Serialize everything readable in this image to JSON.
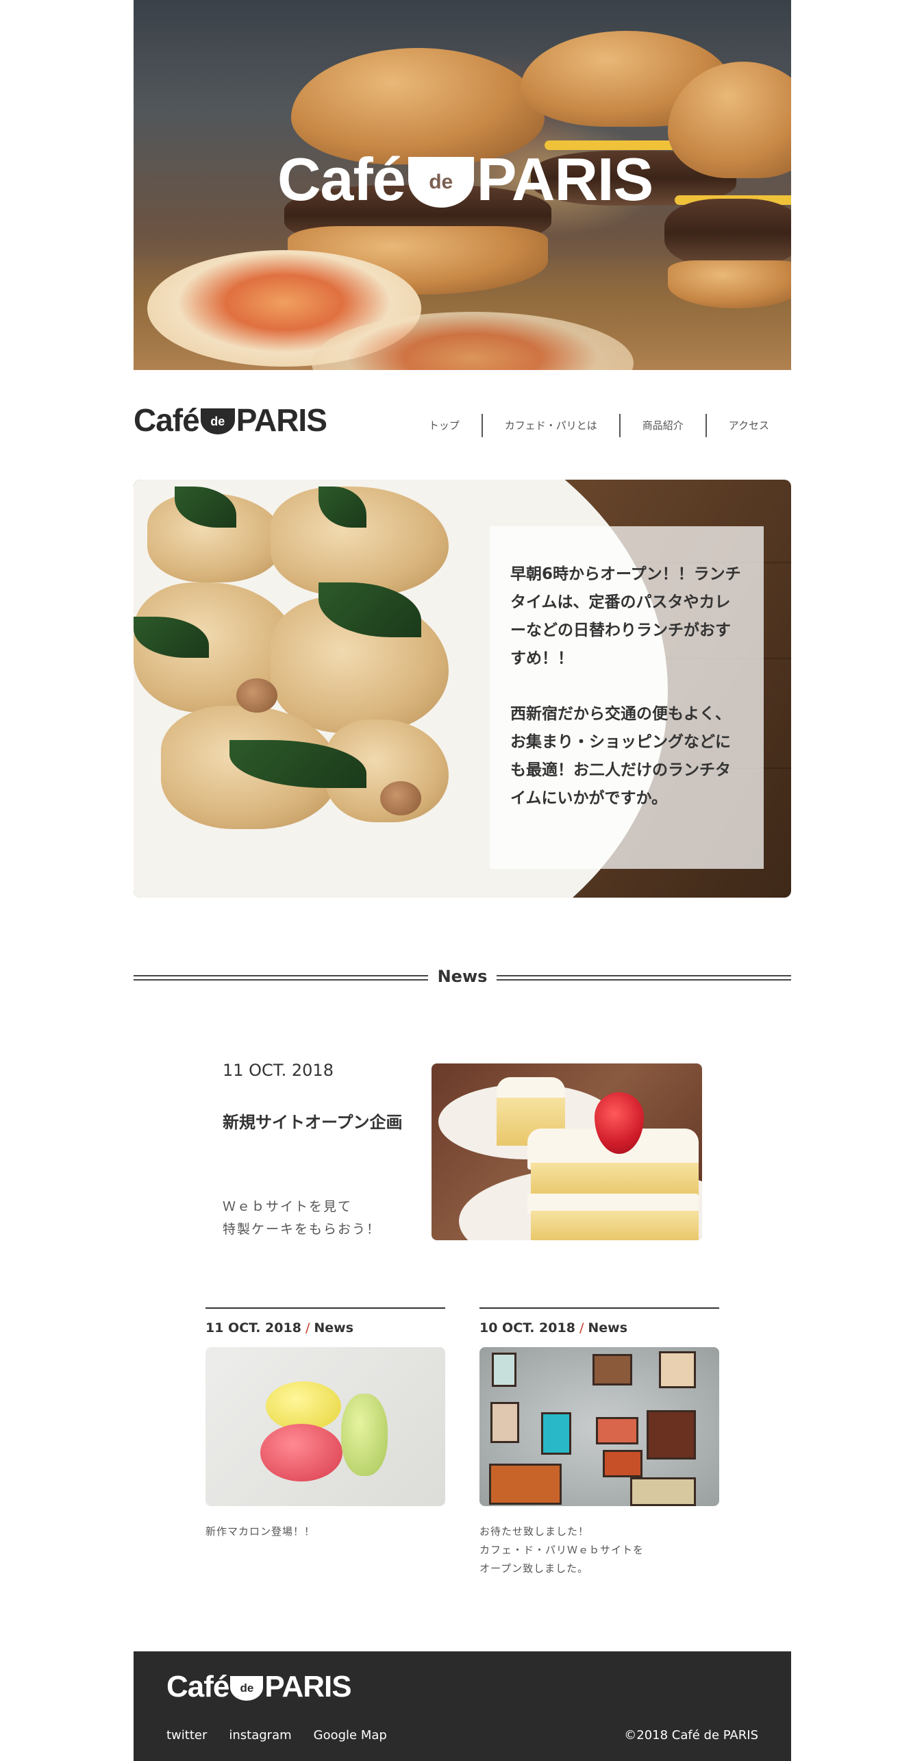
{
  "brand": {
    "cafe": "Café",
    "de": "de",
    "paris": "PARIS"
  },
  "nav": [
    {
      "label": "トップ"
    },
    {
      "label": "カフェド・パリとは"
    },
    {
      "label": "商品紹介"
    },
    {
      "label": "アクセス"
    }
  ],
  "feature": {
    "para1": "早朝6時からオープン！！ランチタイムは、定番のパスタやカレーなどの日替わりランチがおすすめ！！",
    "para2": "西新宿だから交通の便もよく、お集まり・ショッピングなどにも最適！お二人だけのランチタイムにいかがですか。"
  },
  "news": {
    "heading": "News",
    "main": {
      "date": "11 OCT. 2018",
      "title": "新規サイトオープン企画",
      "line1": "Ｗｅｂサイトを見て",
      "line2": "特製ケーキをもらおう！"
    },
    "cards": [
      {
        "date": "11 OCT. 2018",
        "sep": "/",
        "category": "News",
        "lines": [
          "新作マカロン登場！！"
        ]
      },
      {
        "date": "10 OCT. 2018",
        "sep": "/",
        "category": "News",
        "lines": [
          "お待たせ致しました！",
          "カフェ・ド・パリＷｅｂサイトを",
          "オープン致しました。"
        ]
      }
    ]
  },
  "footer": {
    "links": [
      {
        "label": "twitter"
      },
      {
        "label": "instagram"
      },
      {
        "label": "Google Map"
      }
    ],
    "copyright": "©2018 Café de PARIS"
  },
  "colors": {
    "footer_bg": "#2b2b2b",
    "text": "#333333",
    "accent_slash": "#c0392b"
  },
  "icons": [
    "hero-image",
    "pasta-image",
    "cake-image",
    "macaron-image",
    "coffee-signs-image"
  ]
}
